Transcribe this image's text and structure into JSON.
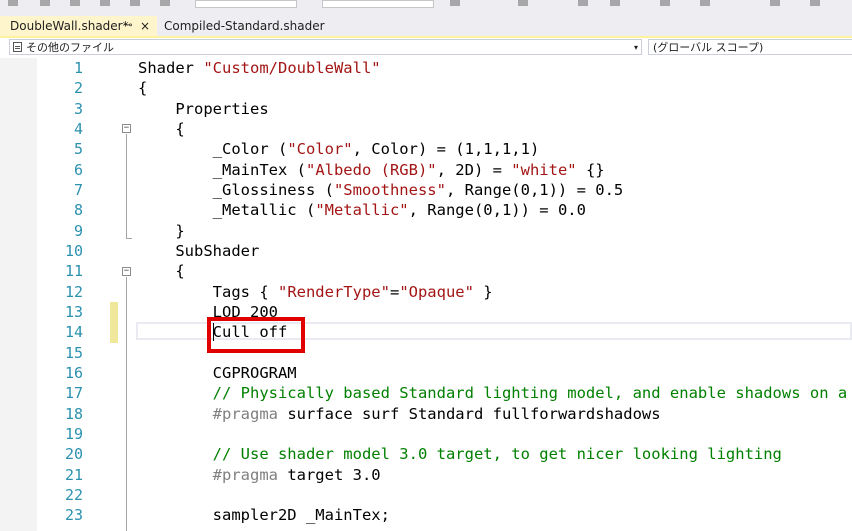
{
  "tabs": [
    {
      "label": "DoubleWall.shader*",
      "active": true,
      "pin": "⊸",
      "close": "×"
    },
    {
      "label": "Compiled-Standard.shader",
      "active": false
    }
  ],
  "navbar": {
    "file_scope": "その他のファイル",
    "global_scope": "(グローバル スコープ)",
    "dropdown_glyph": "▾"
  },
  "editor": {
    "line_numbers": [
      "1",
      "2",
      "3",
      "4",
      "5",
      "6",
      "7",
      "8",
      "9",
      "10",
      "11",
      "12",
      "13",
      "14",
      "15",
      "16",
      "17",
      "18",
      "19",
      "20",
      "21",
      "22",
      "23"
    ],
    "lines": [
      {
        "t": [
          {
            "s": "Shader "
          },
          {
            "s": "\"Custom/DoubleWall\"",
            "c": "str"
          }
        ]
      },
      {
        "t": [
          {
            "s": "{"
          }
        ]
      },
      {
        "t": [
          {
            "s": "    Properties"
          }
        ]
      },
      {
        "t": [
          {
            "s": "    {"
          }
        ]
      },
      {
        "t": [
          {
            "s": "        _Color ("
          },
          {
            "s": "\"Color\"",
            "c": "str"
          },
          {
            "s": ", Color) = (1,1,1,1)"
          }
        ]
      },
      {
        "t": [
          {
            "s": "        _MainTex ("
          },
          {
            "s": "\"Albedo (RGB)\"",
            "c": "str"
          },
          {
            "s": ", 2D) = "
          },
          {
            "s": "\"white\"",
            "c": "str"
          },
          {
            "s": " {}"
          }
        ]
      },
      {
        "t": [
          {
            "s": "        _Glossiness ("
          },
          {
            "s": "\"Smoothness\"",
            "c": "str"
          },
          {
            "s": ", Range(0,1)) = 0.5"
          }
        ]
      },
      {
        "t": [
          {
            "s": "        _Metallic ("
          },
          {
            "s": "\"Metallic\"",
            "c": "str"
          },
          {
            "s": ", Range(0,1)) = 0.0"
          }
        ]
      },
      {
        "t": [
          {
            "s": "    }"
          }
        ]
      },
      {
        "t": [
          {
            "s": "    SubShader"
          }
        ]
      },
      {
        "t": [
          {
            "s": "    {"
          }
        ]
      },
      {
        "t": [
          {
            "s": "        Tags { "
          },
          {
            "s": "\"RenderType\"",
            "c": "str"
          },
          {
            "s": "="
          },
          {
            "s": "\"Opaque\"",
            "c": "str"
          },
          {
            "s": " }"
          }
        ]
      },
      {
        "t": [
          {
            "s": "        LOD 200"
          }
        ]
      },
      {
        "t": [
          {
            "s": "        Cull off"
          }
        ]
      },
      {
        "t": [
          {
            "s": ""
          }
        ]
      },
      {
        "t": [
          {
            "s": "        CGPROGRAM"
          }
        ]
      },
      {
        "t": [
          {
            "s": "        // Physically based Standard lighting model, and enable shadows on a",
            "c": "cmt"
          }
        ]
      },
      {
        "t": [
          {
            "s": "        #pragma",
            "c": "kw"
          },
          {
            "s": " surface surf Standard fullforwardshadows"
          }
        ]
      },
      {
        "t": [
          {
            "s": ""
          }
        ]
      },
      {
        "t": [
          {
            "s": "        // Use shader model 3.0 target, to get nicer looking lighting",
            "c": "cmt"
          }
        ]
      },
      {
        "t": [
          {
            "s": "        #pragma",
            "c": "kw"
          },
          {
            "s": " target 3.0"
          }
        ]
      },
      {
        "t": [
          {
            "s": ""
          }
        ]
      },
      {
        "t": [
          {
            "s": "        sampler2D _MainTex;"
          }
        ]
      }
    ],
    "changed_lines": [
      13,
      14
    ],
    "highlighted_text": "Cull off",
    "colors": {
      "string": "#a31515",
      "comment": "#008000",
      "keyword": "#7f7f7f",
      "line_number": "#2b91af",
      "highlight_box": "#e00000"
    }
  }
}
